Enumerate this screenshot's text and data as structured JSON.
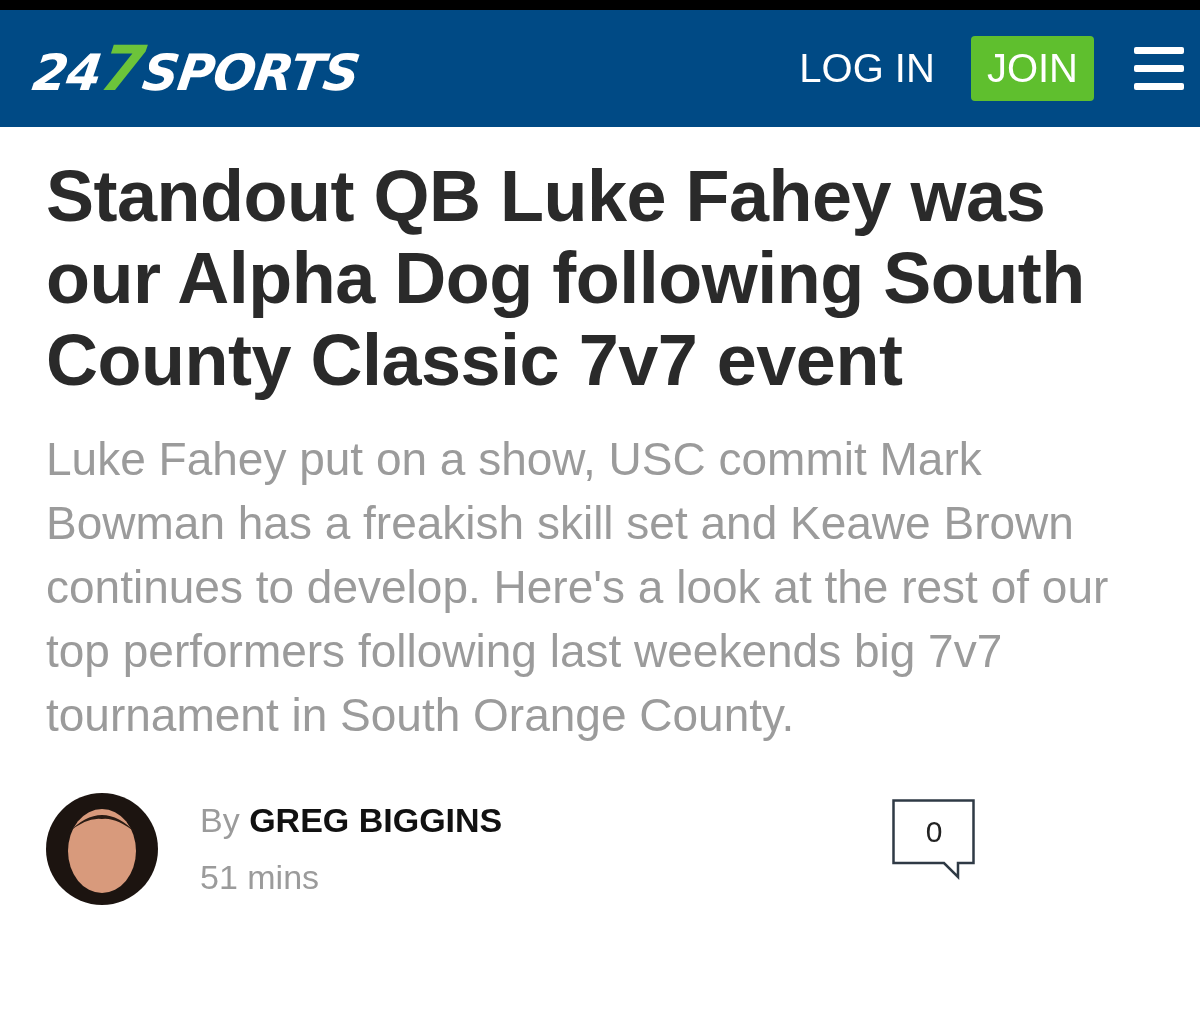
{
  "header": {
    "logo": {
      "prefix": "24",
      "accent": "7",
      "suffix": "SPORTS"
    },
    "login": "LOG IN",
    "join": "JOIN"
  },
  "article": {
    "title": "Standout QB Luke Fahey was our Alpha Dog following South County Classic 7v7 event",
    "summary": "Luke Fahey put on a show, USC commit Mark Bowman has a freakish skill set and Keawe Brown continues to develop. Here's a look at the rest of our top performers following last weekends big 7v7 tournament in South Orange County.",
    "byline": {
      "by": "By",
      "author": "GREG BIGGINS",
      "time": "51 mins"
    },
    "comments": "0"
  }
}
